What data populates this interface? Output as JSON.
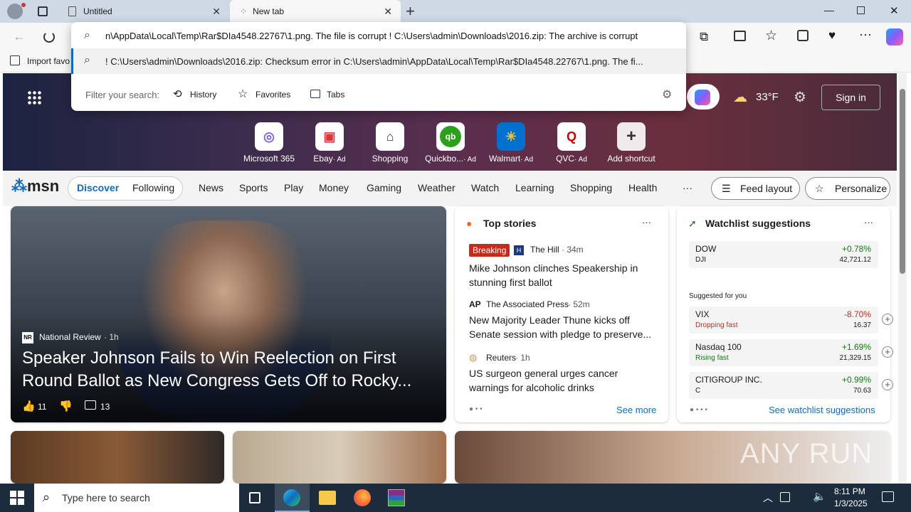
{
  "tabs": [
    {
      "label": "Untitled"
    },
    {
      "label": "New tab"
    }
  ],
  "omnibox": {
    "input_value": "n\\AppData\\Local\\Temp\\Rar$DIa4548.22767\\1.png. The file is corrupt ! C:\\Users\\admin\\Downloads\\2016.zip: The archive is corrupt",
    "suggestion": "! C:\\Users\\admin\\Downloads\\2016.zip: Checksum error in C:\\Users\\admin\\AppData\\Local\\Temp\\Rar$DIa4548.22767\\1.png. The fi...",
    "filter_label": "Filter your search:",
    "filters": [
      "History",
      "Favorites",
      "Tabs"
    ]
  },
  "favbar": {
    "import_label": "Import favo"
  },
  "hero": {
    "weather": "33°F",
    "signin": "Sign in"
  },
  "shortcuts": [
    {
      "label": "Microsoft 365",
      "ad": ""
    },
    {
      "label": "Ebay",
      "ad": "· Ad"
    },
    {
      "label": "Shopping",
      "ad": ""
    },
    {
      "label": "Quickbo...",
      "ad": "· Ad"
    },
    {
      "label": "Walmart",
      "ad": "· Ad"
    },
    {
      "label": "QVC",
      "ad": "· Ad"
    },
    {
      "label": "Add shortcut",
      "ad": ""
    }
  ],
  "msn": {
    "logo": "msn",
    "tabs": [
      "Discover",
      "Following"
    ],
    "nav": [
      "News",
      "Sports",
      "Play",
      "Money",
      "Gaming",
      "Weather",
      "Watch",
      "Learning",
      "Shopping",
      "Health"
    ],
    "more": "···",
    "feed_layout": "Feed layout",
    "personalize": "Personalize"
  },
  "main_story": {
    "source_badge": "NR",
    "source": "National Review",
    "age": "· 1h",
    "headline": "Speaker Johnson Fails to Win Reelection on First Round Ballot as New Congress Gets Off to Rocky...",
    "likes": "11",
    "comments": "13"
  },
  "top_stories": {
    "title": "Top stories",
    "more": "···",
    "items": [
      {
        "badge": "Breaking",
        "source": "The Hill",
        "age": "· 34m",
        "headline": "Mike Johnson clinches Speakership in stunning first ballot"
      },
      {
        "badge": "AP",
        "source": "The Associated Press",
        "age": "· 52m",
        "headline": "New Majority Leader Thune kicks off Senate session with pledge to preserve..."
      },
      {
        "badge": "",
        "source": "Reuters",
        "age": "· 1h",
        "headline": "US surgeon general urges cancer warnings for alcoholic drinks"
      }
    ],
    "see_more": "See more"
  },
  "watchlist": {
    "title": "Watchlist suggestions",
    "more": "···",
    "dow": {
      "name": "DOW",
      "sub": "DJI",
      "pct": "+0.78%",
      "val": "42,721.12"
    },
    "suggested_label": "Suggested for you",
    "items": [
      {
        "name": "VIX",
        "status": "Dropping fast",
        "pct": "-8.70%",
        "val": "16.37",
        "color": "#c42b1c"
      },
      {
        "name": "Nasdaq 100",
        "status": "Rising fast",
        "pct": "+1.69%",
        "val": "21,329.15",
        "color": "#107c10"
      },
      {
        "name": "CITIGROUP INC.",
        "status": "C",
        "pct": "+0.99%",
        "val": "70.63",
        "color": "#107c10"
      }
    ],
    "see_all": "See watchlist suggestions"
  },
  "watermark": "ANY RUN",
  "taskbar": {
    "search_placeholder": "Type here to search",
    "time": "8:11 PM",
    "date": "1/3/2025"
  },
  "colors": {
    "accent": "#0f6cbd",
    "up": "#107c10",
    "down": "#c42b1c",
    "breaking": "#c42b1c"
  }
}
